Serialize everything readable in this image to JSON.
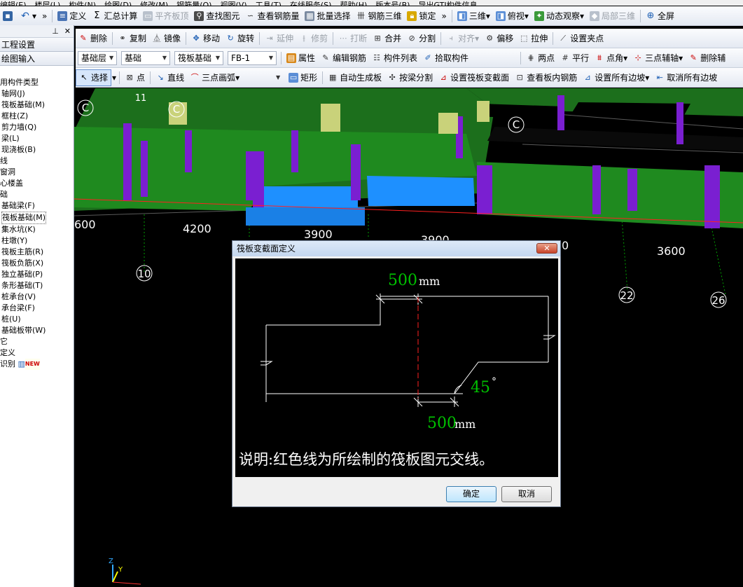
{
  "menubar": {
    "items": [
      "编辑(E)",
      "楼层(L)",
      "构件(N)",
      "绘图(D)",
      "修改(M)",
      "钢筋量(Q)",
      "视图(V)",
      "工具(T)",
      "在线服务(S)",
      "帮助(H)",
      "版本号(B)",
      "导出GTJ构件信息"
    ]
  },
  "toolbar1": {
    "define": "定义",
    "sum_calc": "汇总计算",
    "flat_top": "平齐板顶",
    "find_elem": "查找图元",
    "view_rebar": "查看钢筋量",
    "batch_select": "批量选择",
    "rebar_3d": "钢筋三维",
    "lock": "锁定",
    "three_d": "三维",
    "top_view": "俯视",
    "dynamic_view": "动态观察",
    "local_3d": "局部三维",
    "fullscreen": "全屏"
  },
  "toolbar2": {
    "delete": "删除",
    "copy": "复制",
    "mirror": "镜像",
    "move": "移动",
    "rotate": "旋转",
    "extend": "延伸",
    "trim": "修剪",
    "break": "打断",
    "merge": "合并",
    "split": "分割",
    "align": "对齐",
    "offset": "偏移",
    "stretch": "拉伸",
    "set_grip": "设置夹点"
  },
  "toolbar3": {
    "layer": "基础层",
    "category": "基础",
    "type": "筏板基础",
    "element": "FB-1",
    "attributes": "属性",
    "edit_rebar": "编辑钢筋",
    "comp_list": "构件列表",
    "pick_comp": "拾取构件",
    "two_points": "两点",
    "parallel": "平行",
    "point_angle": "点角",
    "three_point_aux": "三点辅轴",
    "delete_aux": "删除辅"
  },
  "toolbar4": {
    "select": "选择",
    "point": "点",
    "line": "直线",
    "arc3": "三点画弧",
    "rect": "矩形",
    "auto_gen": "自动生成板",
    "by_beam_split": "按梁分割",
    "set_section": "设置筏板变截面",
    "view_rebar_in": "查看板内钢筋",
    "set_all_slope": "设置所有边坡",
    "cancel_all_slope": "取消所有边坡"
  },
  "left_panel": {
    "tab_project": "工程设置",
    "tab_draw": "绘图输入",
    "items": [
      "用构件类型",
      "轴网(J)",
      "筏板基础(M)",
      "框柱(Z)",
      "剪力墙(Q)",
      "梁(L)",
      "现浇板(B)",
      "线",
      "",
      "",
      "窗洞",
      "",
      "",
      "心楼盖",
      "础",
      "基础梁(F)",
      "筏板基础(M)",
      "集水坑(K)",
      "柱墩(Y)",
      "筏板主筋(R)",
      "筏板负筋(X)",
      "独立基础(P)",
      "条形基础(T)",
      "桩承台(V)",
      "承台梁(F)",
      "桩(U)",
      "基础板带(W)",
      "它",
      "定义",
      "识别"
    ],
    "new_badge": "NEW"
  },
  "viewport": {
    "axis_labels": [
      "C",
      "C",
      "C",
      "11",
      "10",
      "22",
      "26"
    ],
    "dims": [
      "600",
      "4200",
      "3900",
      "3900",
      "3600",
      "0"
    ]
  },
  "dialog": {
    "title": "筏板变截面定义",
    "top_width": "500",
    "bottom_width": "500",
    "unit": "mm",
    "angle": "45",
    "degree": "°",
    "note": "说明:红色线为所绘制的筏板图元交线。",
    "ok": "确定",
    "cancel": "取消"
  },
  "colors": {
    "green_line": "#00c000",
    "red_line": "#ff0000",
    "slab_green": "#1f8a1f",
    "purple": "#8a2be2",
    "blue": "#1e90ff"
  }
}
